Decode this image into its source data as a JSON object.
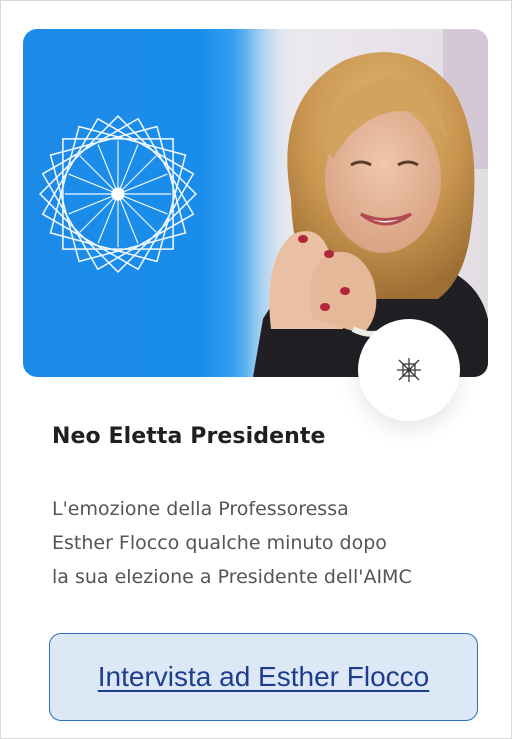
{
  "card": {
    "hero_alt": "Esther Flocco",
    "title": "Neo Eletta Presidente",
    "description": [
      "L'emozione della Professoressa",
      "Esther Flocco qualche minuto dopo",
      "la sua elezione a Presidente dell'AIMC"
    ],
    "badge_icon": "aimc-logo-icon",
    "link_label": "Intervista ad Esther Flocco"
  },
  "colors": {
    "hero_blue": "#1c8be8",
    "title_text": "#1f1f1f",
    "body_text": "#555555",
    "button_fill": "#dce8f6",
    "button_border": "#2d6fb8",
    "link_text": "#1f3d8f"
  }
}
